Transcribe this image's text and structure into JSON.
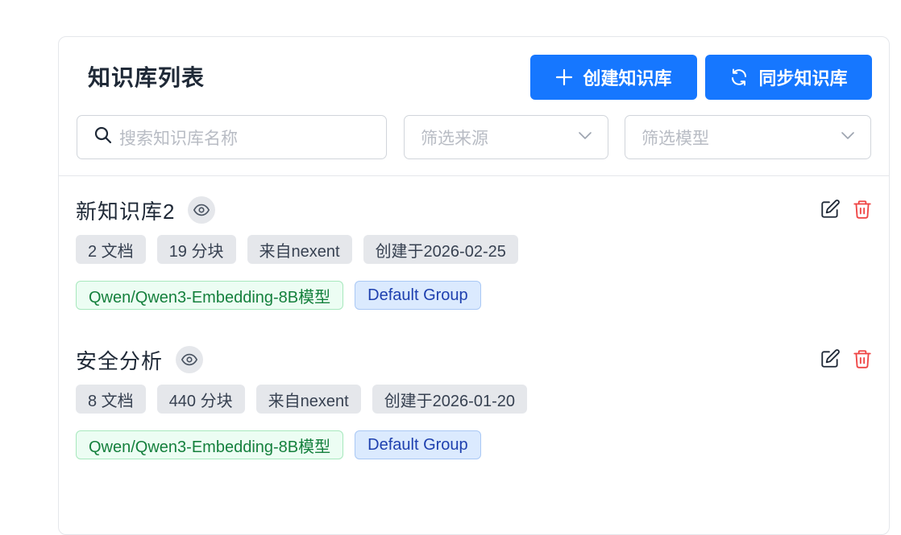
{
  "header": {
    "title": "知识库列表",
    "create_button": "创建知识库",
    "sync_button": "同步知识库"
  },
  "filters": {
    "search_placeholder": "搜索知识库名称",
    "source_placeholder": "筛选来源",
    "model_placeholder": "筛选模型"
  },
  "knowledge_bases": [
    {
      "name": "新知识库2",
      "docs": "2 文档",
      "chunks": "19 分块",
      "source": "来自nexent",
      "created": "创建于2026-02-25",
      "model": "Qwen/Qwen3-Embedding-8B模型",
      "group": "Default Group"
    },
    {
      "name": "安全分析",
      "docs": "8 文档",
      "chunks": "440 分块",
      "source": "来自nexent",
      "created": "创建于2026-01-20",
      "model": "Qwen/Qwen3-Embedding-8B模型",
      "group": "Default Group"
    }
  ],
  "colors": {
    "primary": "#1677ff",
    "danger": "#ef4444",
    "model_tag": "#15803d",
    "group_tag": "#1e40af"
  },
  "icons": {
    "create": "plus-icon",
    "sync": "sync-icon",
    "search": "search-icon",
    "dropdown": "chevron-down-icon",
    "preview": "eye-icon",
    "edit": "edit-icon",
    "delete": "trash-icon"
  }
}
